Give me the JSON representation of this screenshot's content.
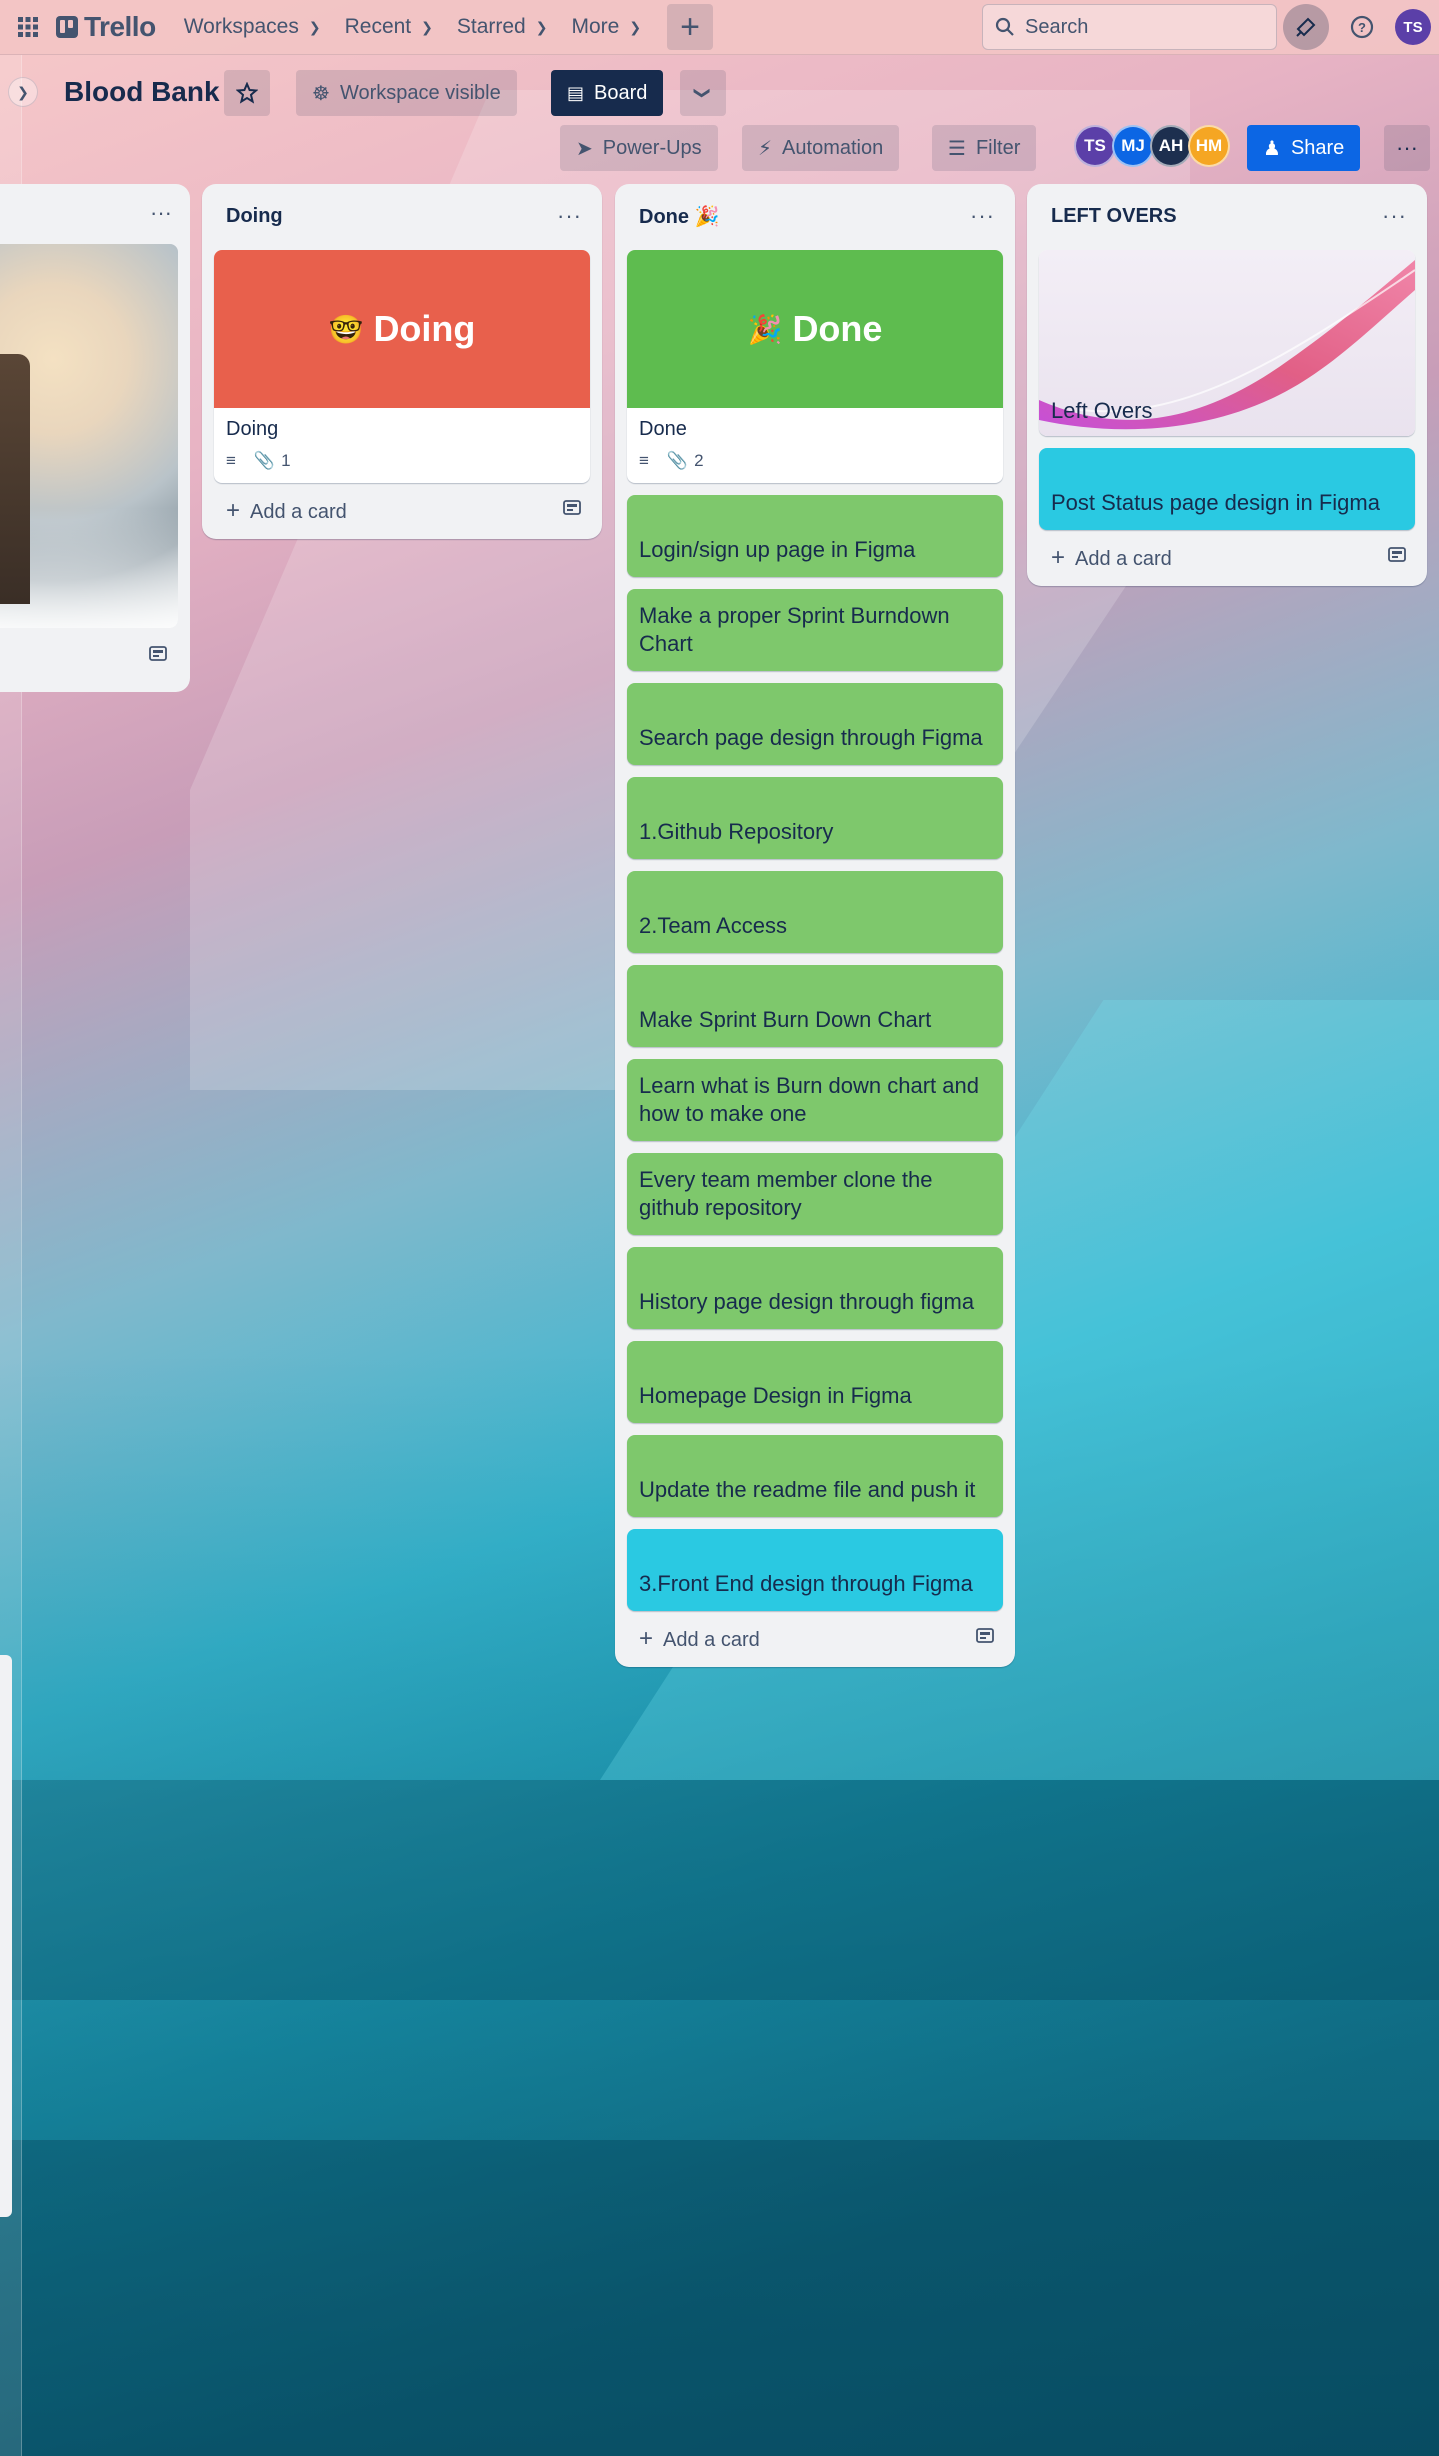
{
  "topnav": {
    "logo": "Trello",
    "menus": [
      "Workspaces",
      "Recent",
      "Starred",
      "More"
    ],
    "search_placeholder": "Search",
    "user_initials": "TS"
  },
  "board": {
    "title": "Blood Bank",
    "visibility": "Workspace visible",
    "view": "Board",
    "power_ups": "Power-Ups",
    "automation": "Automation",
    "filter": "Filter",
    "share": "Share",
    "members": [
      {
        "initials": "TS",
        "color": "#5b3fa8"
      },
      {
        "initials": "MJ",
        "color": "#0c66e4"
      },
      {
        "initials": "AH",
        "color": "#1d2f4f"
      },
      {
        "initials": "HM",
        "color": "#f5a623"
      }
    ]
  },
  "lists": {
    "doing": {
      "title": "Doing",
      "cover_text": "Doing",
      "cover_emoji": "🤓",
      "cover_color": "#e8604c",
      "card_title": "Doing",
      "attachments": "1",
      "add_card": "Add a card"
    },
    "done": {
      "title": "Done 🎉",
      "cover_text": "Done",
      "cover_emoji": "🎉",
      "cover_color": "#5ebc4f",
      "card_title": "Done",
      "attachments": "2",
      "cards": [
        "Login/sign up page in Figma",
        "Make a proper Sprint Burndown Chart",
        "Search page design through Figma",
        "1.Github Repository",
        "2.Team Access",
        "Make Sprint Burn Down Chart",
        "Learn what is Burn down chart and how to make one",
        "Every team member clone the github repository",
        "History page design through figma",
        "Homepage Design in Figma",
        "Update the readme file and push it",
        "3.Front End design through Figma"
      ],
      "add_card": "Add a card"
    },
    "leftovers": {
      "title": "LEFT OVERS",
      "cover_card_title": "Left Overs",
      "card": "Post Status page design in Figma",
      "add_card": "Add a card"
    }
  }
}
